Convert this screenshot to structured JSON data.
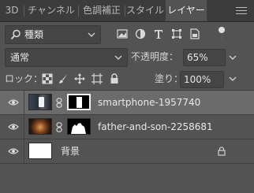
{
  "tabs": [
    {
      "label": "3D"
    },
    {
      "label": "チャンネル"
    },
    {
      "label": "色調補正"
    },
    {
      "label": "スタイル"
    },
    {
      "label": "レイヤー"
    }
  ],
  "filter": {
    "kind_label": "種類"
  },
  "blend": {
    "mode": "通常",
    "opacity_label": "不透明度：",
    "opacity_value": "65%"
  },
  "locks": {
    "label": "ロック：",
    "fill_label": "塗り：",
    "fill_value": "100%"
  },
  "layers": [
    {
      "name": "smartphone-1957740",
      "visible": true,
      "selected": true
    },
    {
      "name": "father-and-son-2258681",
      "visible": true,
      "selected": false
    },
    {
      "name": "背景",
      "visible": true,
      "selected": false,
      "locked": true
    }
  ]
}
